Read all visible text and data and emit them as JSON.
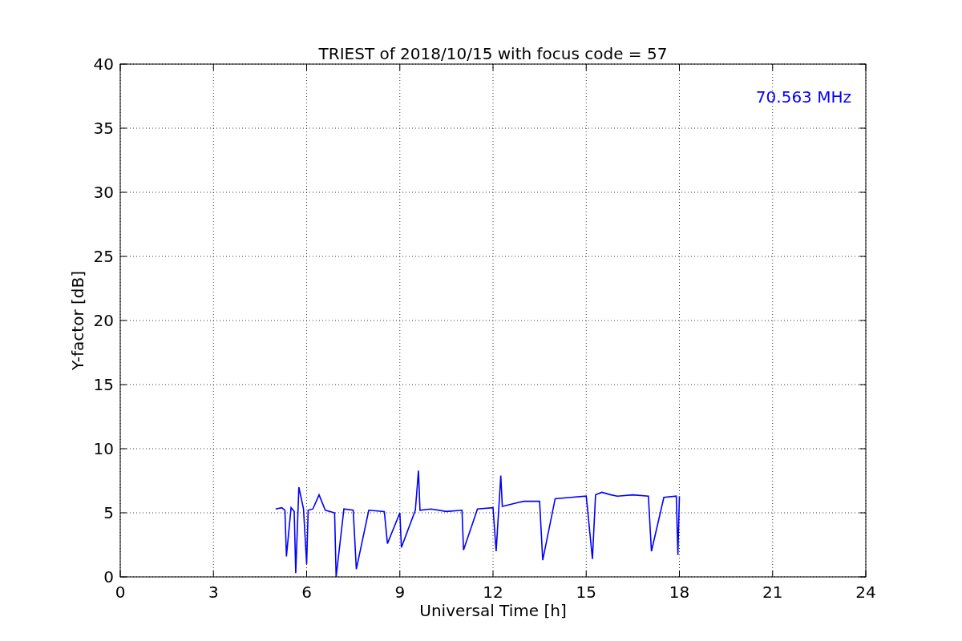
{
  "chart_data": {
    "type": "line",
    "grid": true,
    "title": "TRIEST of 2018/10/15 with focus code = 57",
    "xlabel": "Universal Time [h]",
    "ylabel": "Y-factor [dB]",
    "xlim": [
      0,
      24
    ],
    "ylim": [
      0,
      40
    ],
    "xticks": [
      0,
      3,
      6,
      9,
      12,
      15,
      18,
      21,
      24
    ],
    "yticks": [
      0,
      5,
      10,
      15,
      20,
      25,
      30,
      35,
      40
    ],
    "x": [
      5.0,
      5.2,
      5.3,
      5.35,
      5.5,
      5.6,
      5.65,
      5.75,
      5.9,
      6.0,
      6.05,
      6.2,
      6.4,
      6.6,
      6.9,
      6.95,
      7.2,
      7.5,
      7.6,
      8.0,
      8.5,
      8.6,
      9.0,
      9.05,
      9.5,
      9.6,
      9.65,
      10.0,
      10.5,
      11.0,
      11.05,
      11.5,
      12.0,
      12.1,
      12.25,
      12.3,
      12.8,
      13.0,
      13.5,
      13.6,
      14.0,
      14.5,
      15.0,
      15.2,
      15.3,
      15.5,
      15.8,
      16.0,
      16.5,
      17.0,
      17.1,
      17.5,
      17.9,
      17.95,
      18.0
    ],
    "series": [
      {
        "name": "70.563 MHz",
        "color": "#0000ff",
        "values": [
          5.3,
          5.4,
          5.2,
          1.6,
          5.4,
          5.1,
          0.3,
          7.0,
          5.3,
          1.0,
          5.2,
          5.3,
          6.4,
          5.2,
          5.0,
          0,
          5.3,
          5.2,
          0.6,
          5.2,
          5.1,
          2.6,
          5.0,
          2.3,
          5.2,
          8.3,
          5.2,
          5.3,
          5.1,
          5.2,
          2.1,
          5.3,
          5.4,
          2.0,
          7.9,
          5.5,
          5.8,
          5.9,
          5.9,
          1.3,
          6.1,
          6.2,
          6.3,
          1.4,
          6.4,
          6.6,
          6.4,
          6.3,
          6.4,
          6.3,
          2.0,
          6.2,
          6.3,
          1.7,
          6.3
        ]
      }
    ]
  }
}
